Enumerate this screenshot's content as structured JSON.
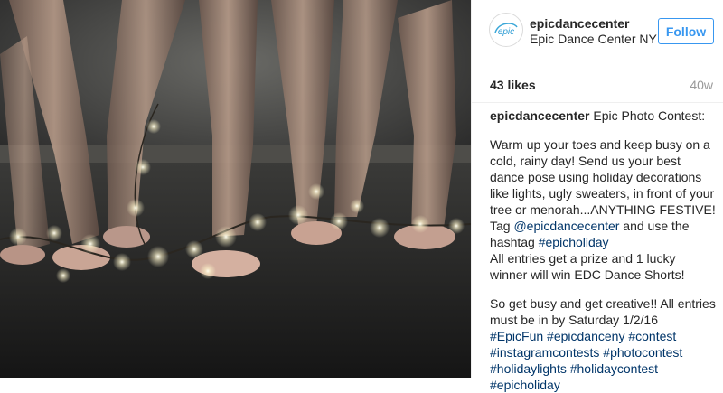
{
  "post": {
    "photo_description": "Dancers' legs in ballet slippers wrapped with holiday string lights"
  },
  "header": {
    "username": "epicdancecenter",
    "full_name": "Epic Dance Center NY",
    "follow_label": "Follow",
    "avatar_text": "epic"
  },
  "stats": {
    "likes": "43 likes",
    "time": "40w"
  },
  "caption": {
    "username": "epicdancecenter",
    "title": " Epic Photo Contest:",
    "body1": "Warm up your toes and keep busy on a cold, rainy day! Send us your best dance pose using holiday decorations like lights, ugly sweaters, in front of your tree or menorah...ANYTHING FESTIVE! Tag ",
    "mention": "@epicdancecenter",
    "body2": " and use the hashtag ",
    "hashtag1": "#epicholiday",
    "body3": "All entries get a prize and 1 lucky winner will win EDC Dance Shorts!",
    "body4": "So get busy and get creative!! All entries must be in by Saturday 1/2/16",
    "tags": [
      "#EpicFun",
      "#epicdanceny",
      "#contest",
      "#instagramcontests",
      "#photocontest",
      "#holidaylights",
      "#holidaycontest",
      "#epicholiday"
    ]
  },
  "colors": {
    "link": "#003569",
    "follow_blue": "#3897f0",
    "muted": "#999999"
  }
}
